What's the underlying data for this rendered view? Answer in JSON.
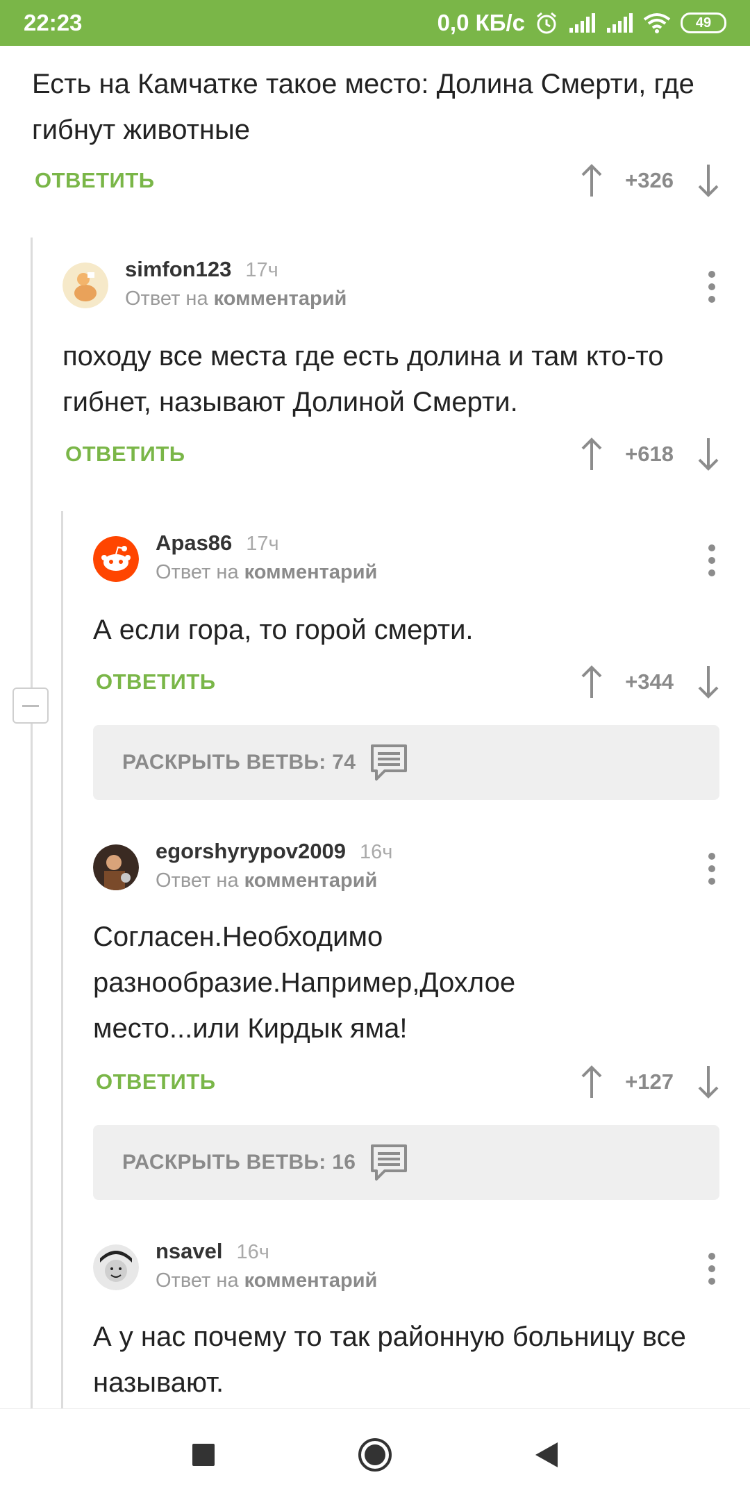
{
  "status_bar": {
    "time": "22:23",
    "network_speed": "0,0 КБ/с",
    "battery": "49",
    "icons": [
      "alarm-icon",
      "signal-icon",
      "signal-icon",
      "wifi-icon",
      "battery-icon"
    ]
  },
  "colors": {
    "accent": "#7ab648",
    "muted": "#8a8a8a",
    "box": "#efefef"
  },
  "top_comment": {
    "text": "Есть на Камчатке такое место: Долина Смерти, где гибнут животные",
    "reply_label": "ОТВЕТИТЬ",
    "score": "+326"
  },
  "comments": [
    {
      "user": "simfon123",
      "time": "17ч",
      "reply_to_prefix": "Ответ на",
      "reply_to_target": "комментарий",
      "text": "походу все места где есть долина и там кто-то гибнет, называют Долиной Смерти.",
      "reply_label": "ОТВЕТИТЬ",
      "score": "+618"
    },
    {
      "user": "Apas86",
      "time": "17ч",
      "reply_to_prefix": "Ответ на",
      "reply_to_target": "комментарий",
      "text": "А если гора, то горой смерти.",
      "reply_label": "ОТВЕТИТЬ",
      "score": "+344",
      "expand_label": "РАСКРЫТЬ ВЕТВЬ: 74"
    },
    {
      "user": "egorshyrypov2009",
      "time": "16ч",
      "reply_to_prefix": "Ответ на",
      "reply_to_target": "комментарий",
      "text": "Согласен.Необходимо разнообразие.Например,Дохлое место...или Кирдык яма!",
      "reply_label": "ОТВЕТИТЬ",
      "score": "+127",
      "expand_label": "РАСКРЫТЬ ВЕТВЬ: 16"
    },
    {
      "user": "nsavel",
      "time": "16ч",
      "reply_to_prefix": "Ответ на",
      "reply_to_target": "комментарий",
      "text": "А у нас почему то так районную больницу все называют."
    }
  ],
  "nav": [
    "recents-icon",
    "home-icon",
    "back-icon"
  ]
}
